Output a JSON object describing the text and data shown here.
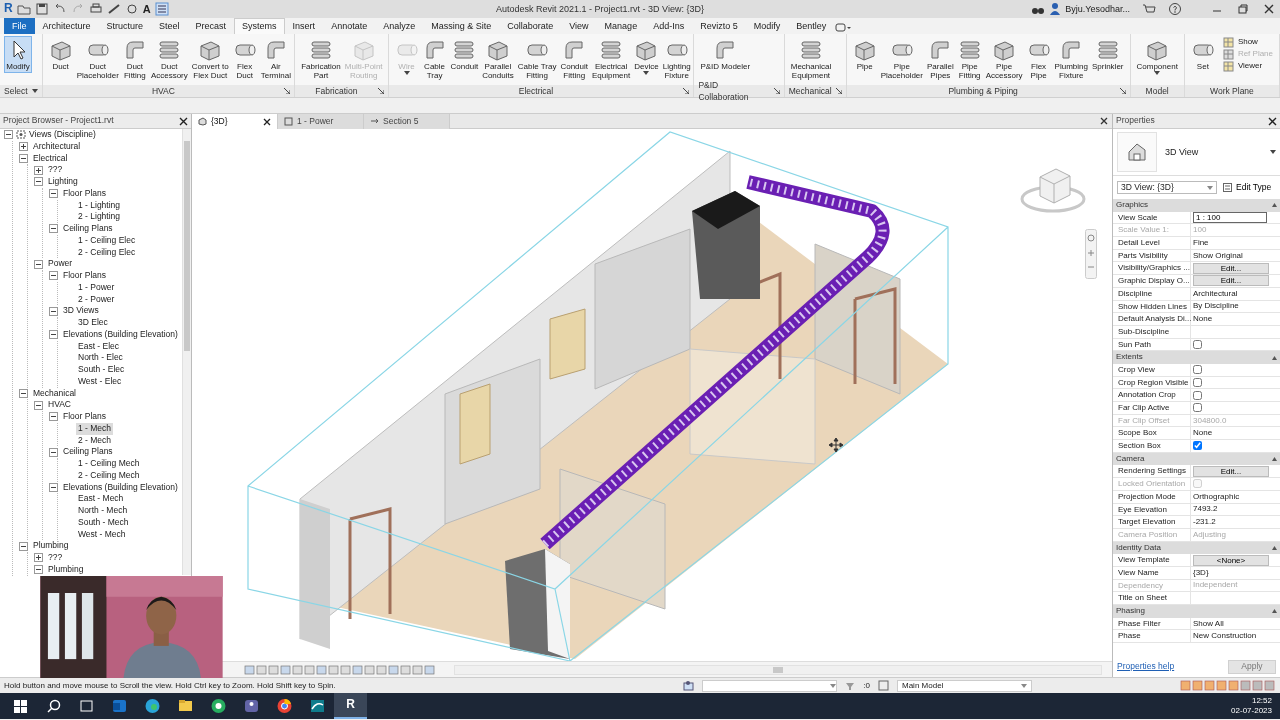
{
  "title_bar": {
    "app_logo": "R",
    "quick_text": "A",
    "title": "Autodesk Revit 2021.1 - Project1.rvt - 3D View: {3D}",
    "user": "Byju.Yesodhar..."
  },
  "ribbon_tabs": [
    {
      "label": "File",
      "kind": "application",
      "selected": false
    },
    {
      "label": "Architecture",
      "kind": "tab",
      "selected": false
    },
    {
      "label": "Structure",
      "kind": "tab",
      "selected": false
    },
    {
      "label": "Steel",
      "kind": "tab",
      "selected": false
    },
    {
      "label": "Precast",
      "kind": "tab",
      "selected": false
    },
    {
      "label": "Systems",
      "kind": "tab",
      "selected": true
    },
    {
      "label": "Insert",
      "kind": "tab",
      "selected": false
    },
    {
      "label": "Annotate",
      "kind": "tab",
      "selected": false
    },
    {
      "label": "Analyze",
      "kind": "tab",
      "selected": false
    },
    {
      "label": "Massing & Site",
      "kind": "tab",
      "selected": false
    },
    {
      "label": "Collaborate",
      "kind": "tab",
      "selected": false
    },
    {
      "label": "View",
      "kind": "tab",
      "selected": false
    },
    {
      "label": "Manage",
      "kind": "tab",
      "selected": false
    },
    {
      "label": "Add-Ins",
      "kind": "tab",
      "selected": false
    },
    {
      "label": "Revizto 5",
      "kind": "tab",
      "selected": false
    },
    {
      "label": "Modify",
      "kind": "tab",
      "selected": false
    },
    {
      "label": "Bentley",
      "kind": "tab",
      "selected": false
    }
  ],
  "ribbon_groups": [
    {
      "label": "Select",
      "dropdown": true,
      "launcher": false,
      "buttons": [
        {
          "label": "Modify",
          "kind": "select",
          "active": true,
          "disabled": false,
          "dropdown": false
        }
      ]
    },
    {
      "label": "HVAC",
      "dropdown": false,
      "launcher": true,
      "buttons": [
        {
          "label": "Duct",
          "kind": "large",
          "disabled": false,
          "dropdown": false
        },
        {
          "label": "Duct\nPlaceholder",
          "kind": "large",
          "disabled": false,
          "dropdown": false
        },
        {
          "label": "Duct\nFitting",
          "kind": "large",
          "disabled": false,
          "dropdown": false
        },
        {
          "label": "Duct\nAccessory",
          "kind": "large",
          "disabled": false,
          "dropdown": false
        },
        {
          "label": "Convert to\nFlex Duct",
          "kind": "large",
          "disabled": false,
          "dropdown": false
        },
        {
          "label": "Flex\nDuct",
          "kind": "large",
          "disabled": false,
          "dropdown": false
        },
        {
          "label": "Air\nTerminal",
          "kind": "large",
          "disabled": false,
          "dropdown": false
        }
      ]
    },
    {
      "label": "Fabrication",
      "dropdown": false,
      "launcher": true,
      "buttons": [
        {
          "label": "Fabrication\nPart",
          "kind": "large",
          "disabled": false,
          "dropdown": false
        },
        {
          "label": "Multi-Point\nRouting",
          "kind": "large",
          "disabled": true,
          "dropdown": false
        }
      ]
    },
    {
      "label": "Electrical",
      "dropdown": false,
      "launcher": true,
      "buttons": [
        {
          "label": "Wire",
          "kind": "large",
          "disabled": true,
          "dropdown": true
        },
        {
          "label": "Cable\nTray",
          "kind": "large",
          "disabled": false,
          "dropdown": false
        },
        {
          "label": "Conduit",
          "kind": "large",
          "disabled": false,
          "dropdown": false
        },
        {
          "label": "Parallel\nConduits",
          "kind": "large",
          "disabled": false,
          "dropdown": false
        },
        {
          "label": "Cable Tray\nFitting",
          "kind": "large",
          "disabled": false,
          "dropdown": false
        },
        {
          "label": "Conduit\nFitting",
          "kind": "large",
          "disabled": false,
          "dropdown": false
        },
        {
          "label": "Electrical\nEquipment",
          "kind": "large",
          "disabled": false,
          "dropdown": false
        },
        {
          "label": "Device",
          "kind": "large",
          "disabled": false,
          "dropdown": true
        },
        {
          "label": "Lighting\nFixture",
          "kind": "large",
          "disabled": false,
          "dropdown": false
        }
      ]
    },
    {
      "label": "P&ID Collaboration",
      "dropdown": false,
      "launcher": true,
      "buttons": [
        {
          "label": "P&ID Modeler",
          "kind": "large",
          "disabled": false,
          "dropdown": false
        }
      ]
    },
    {
      "label": "Mechanical",
      "dropdown": false,
      "launcher": true,
      "buttons": [
        {
          "label": "Mechanical\nEquipment",
          "kind": "large",
          "disabled": false,
          "dropdown": false
        }
      ]
    },
    {
      "label": "Plumbing & Piping",
      "dropdown": false,
      "launcher": true,
      "buttons": [
        {
          "label": "Pipe",
          "kind": "large",
          "disabled": false,
          "dropdown": false
        },
        {
          "label": "Pipe\nPlaceholder",
          "kind": "large",
          "disabled": false,
          "dropdown": false
        },
        {
          "label": "Parallel\nPipes",
          "kind": "large",
          "disabled": false,
          "dropdown": false
        },
        {
          "label": "Pipe\nFitting",
          "kind": "large",
          "disabled": false,
          "dropdown": false
        },
        {
          "label": "Pipe\nAccessory",
          "kind": "large",
          "disabled": false,
          "dropdown": false
        },
        {
          "label": "Flex\nPipe",
          "kind": "large",
          "disabled": false,
          "dropdown": false
        },
        {
          "label": "Plumbing\nFixture",
          "kind": "large",
          "disabled": false,
          "dropdown": false
        },
        {
          "label": "Sprinkler",
          "kind": "large",
          "disabled": false,
          "dropdown": false
        }
      ]
    },
    {
      "label": "Model",
      "dropdown": false,
      "launcher": false,
      "buttons": [
        {
          "label": "Component",
          "kind": "large",
          "disabled": false,
          "dropdown": true
        }
      ]
    },
    {
      "label": "Work Plane",
      "dropdown": false,
      "launcher": false,
      "buttons": [
        {
          "label": "Set",
          "kind": "large",
          "disabled": false,
          "dropdown": false
        },
        {
          "label": "Show",
          "kind": "small",
          "disabled": false
        },
        {
          "label": "Ref Plane",
          "kind": "small",
          "disabled": true
        },
        {
          "label": "Viewer",
          "kind": "small",
          "disabled": false
        }
      ]
    }
  ],
  "project_browser": {
    "title": "Project Browser - Project1.rvt",
    "tree": [
      {
        "label": "Views (Discipline)",
        "expanded": true,
        "selected": false,
        "children": [
          {
            "label": "Architectural",
            "expanded": false,
            "selected": false
          },
          {
            "label": "Electrical",
            "expanded": true,
            "selected": false,
            "children": [
              {
                "label": "???",
                "expanded": false,
                "selected": false
              },
              {
                "label": "Lighting",
                "expanded": true,
                "selected": false,
                "children": [
                  {
                    "label": "Floor Plans",
                    "expanded": true,
                    "selected": false,
                    "children": [
                      {
                        "label": "1 - Lighting",
                        "selected": false
                      },
                      {
                        "label": "2 - Lighting",
                        "selected": false
                      }
                    ]
                  },
                  {
                    "label": "Ceiling Plans",
                    "expanded": true,
                    "selected": false,
                    "children": [
                      {
                        "label": "1 - Ceiling Elec",
                        "selected": false
                      },
                      {
                        "label": "2 - Ceiling Elec",
                        "selected": false
                      }
                    ]
                  }
                ]
              },
              {
                "label": "Power",
                "expanded": true,
                "selected": false,
                "children": [
                  {
                    "label": "Floor Plans",
                    "expanded": true,
                    "selected": false,
                    "children": [
                      {
                        "label": "1 - Power",
                        "selected": false
                      },
                      {
                        "label": "2 - Power",
                        "selected": false
                      }
                    ]
                  },
                  {
                    "label": "3D Views",
                    "expanded": true,
                    "selected": false,
                    "children": [
                      {
                        "label": "3D Elec",
                        "selected": false
                      }
                    ]
                  },
                  {
                    "label": "Elevations (Building Elevation)",
                    "expanded": true,
                    "selected": false,
                    "children": [
                      {
                        "label": "East - Elec",
                        "selected": false
                      },
                      {
                        "label": "North - Elec",
                        "selected": false
                      },
                      {
                        "label": "South - Elec",
                        "selected": false
                      },
                      {
                        "label": "West - Elec",
                        "selected": false
                      }
                    ]
                  }
                ]
              }
            ]
          },
          {
            "label": "Mechanical",
            "expanded": true,
            "selected": false,
            "children": [
              {
                "label": "HVAC",
                "expanded": true,
                "selected": false,
                "children": [
                  {
                    "label": "Floor Plans",
                    "expanded": true,
                    "selected": false,
                    "children": [
                      {
                        "label": "1 - Mech",
                        "selected": true
                      },
                      {
                        "label": "2 - Mech",
                        "selected": false
                      }
                    ]
                  },
                  {
                    "label": "Ceiling Plans",
                    "expanded": true,
                    "selected": false,
                    "children": [
                      {
                        "label": "1 - Ceiling Mech",
                        "selected": false
                      },
                      {
                        "label": "2 - Ceiling Mech",
                        "selected": false
                      }
                    ]
                  },
                  {
                    "label": "Elevations (Building Elevation)",
                    "expanded": true,
                    "selected": false,
                    "children": [
                      {
                        "label": "East - Mech",
                        "selected": false
                      },
                      {
                        "label": "North - Mech",
                        "selected": false
                      },
                      {
                        "label": "South - Mech",
                        "selected": false
                      },
                      {
                        "label": "West - Mech",
                        "selected": false
                      }
                    ]
                  }
                ]
              }
            ]
          },
          {
            "label": "Plumbing",
            "expanded": true,
            "selected": false,
            "children": [
              {
                "label": "???",
                "expanded": false,
                "selected": false
              },
              {
                "label": "Plumbing",
                "expanded": true,
                "selected": false
              }
            ]
          }
        ]
      }
    ]
  },
  "view_tabs": [
    {
      "label": "{3D}",
      "selected": true
    },
    {
      "label": "1 - Power",
      "selected": false
    },
    {
      "label": "Section 5",
      "selected": false
    }
  ],
  "properties": {
    "title": "Properties",
    "type_name": "3D View",
    "instance": "3D View: {3D}",
    "edit_type": "Edit Type",
    "sections": [
      {
        "title": "Graphics",
        "rows": [
          {
            "name": "View Scale",
            "kind": "input",
            "value": "1 : 100",
            "disabled": false
          },
          {
            "name": "Scale Value    1:",
            "kind": "text",
            "value": "100",
            "disabled": true
          },
          {
            "name": "Detail Level",
            "kind": "text",
            "value": "Fine",
            "disabled": false
          },
          {
            "name": "Parts Visibility",
            "kind": "text",
            "value": "Show Original",
            "disabled": false
          },
          {
            "name": "Visibility/Graphics ...",
            "kind": "button",
            "value": "Edit...",
            "disabled": false
          },
          {
            "name": "Graphic Display O...",
            "kind": "button",
            "value": "Edit...",
            "disabled": false
          },
          {
            "name": "Discipline",
            "kind": "text",
            "value": "Architectural",
            "disabled": false
          },
          {
            "name": "Show Hidden Lines",
            "kind": "text",
            "value": "By Discipline",
            "disabled": false
          },
          {
            "name": "Default Analysis Di...",
            "kind": "text",
            "value": "None",
            "disabled": false
          },
          {
            "name": "Sub-Discipline",
            "kind": "text",
            "disabled": false
          },
          {
            "name": "Sun Path",
            "kind": "checkbox",
            "checked": false,
            "disabled": false
          }
        ]
      },
      {
        "title": "Extents",
        "rows": [
          {
            "name": "Crop View",
            "kind": "checkbox",
            "checked": false,
            "disabled": false
          },
          {
            "name": "Crop Region Visible",
            "kind": "checkbox",
            "checked": false,
            "disabled": false
          },
          {
            "name": "Annotation Crop",
            "kind": "checkbox",
            "checked": false,
            "disabled": false
          },
          {
            "name": "Far Clip Active",
            "kind": "checkbox",
            "checked": false,
            "disabled": false
          },
          {
            "name": "Far Clip Offset",
            "kind": "text",
            "value": "304800.0",
            "disabled": true
          },
          {
            "name": "Scope Box",
            "kind": "text",
            "value": "None",
            "disabled": false
          },
          {
            "name": "Section Box",
            "kind": "checkbox",
            "checked": true,
            "disabled": false
          }
        ]
      },
      {
        "title": "Camera",
        "rows": [
          {
            "name": "Rendering Settings",
            "kind": "button",
            "value": "Edit...",
            "disabled": false
          },
          {
            "name": "Locked Orientation",
            "kind": "checkbox",
            "checked": false,
            "disabled": true
          },
          {
            "name": "Projection Mode",
            "kind": "text",
            "value": "Orthographic",
            "disabled": false
          },
          {
            "name": "Eye Elevation",
            "kind": "text",
            "value": "7493.2",
            "disabled": false
          },
          {
            "name": "Target Elevation",
            "kind": "text",
            "value": "-231.2",
            "disabled": false
          },
          {
            "name": "Camera Position",
            "kind": "text",
            "value": "Adjusting",
            "disabled": true
          }
        ]
      },
      {
        "title": "Identity Data",
        "rows": [
          {
            "name": "View Template",
            "kind": "button",
            "value": "<None>",
            "disabled": false
          },
          {
            "name": "View Name",
            "kind": "text",
            "value": "{3D}",
            "disabled": false
          },
          {
            "name": "Dependency",
            "kind": "text",
            "value": "Independent",
            "disabled": true
          },
          {
            "name": "Title on Sheet",
            "kind": "text",
            "disabled": false
          }
        ]
      },
      {
        "title": "Phasing",
        "rows": [
          {
            "name": "Phase Filter",
            "kind": "text",
            "value": "Show All",
            "disabled": false
          },
          {
            "name": "Phase",
            "kind": "text",
            "value": "New Construction",
            "disabled": false
          }
        ]
      }
    ],
    "help_link": "Properties help",
    "apply": {
      "label": "Apply",
      "disabled": true
    }
  },
  "status_bar": {
    "message": "Hold button and move mouse to Scroll the view. Hold Ctrl key to Zoom. Hold Shift key to Spin.",
    "count": ":0",
    "model": "Main Model"
  },
  "taskbar": {
    "app_letter": "R",
    "time": "12:52",
    "date": "02-07-2023"
  }
}
